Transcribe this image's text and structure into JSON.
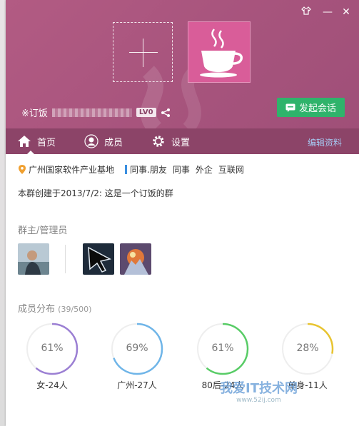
{
  "header": {
    "window_controls": [
      {
        "name": "skin",
        "icon": "shirt-icon"
      },
      {
        "name": "minimize",
        "icon": "minimize-icon",
        "glyph": "—"
      },
      {
        "name": "close",
        "icon": "close-icon",
        "glyph": "✕"
      }
    ],
    "group_name": "※订饭",
    "level": "LV0",
    "chat_button": "发起会话",
    "colors": {
      "header": "#a9557e",
      "tabs": "#8c4468",
      "chat_button": "#2fb36b",
      "avatar": "#d95d99"
    }
  },
  "tabs": [
    {
      "label": "首页",
      "icon": "home-icon",
      "active": true
    },
    {
      "label": "成员",
      "icon": "member-icon",
      "active": false
    },
    {
      "label": "设置",
      "icon": "gear-icon",
      "active": false
    }
  ],
  "edit_link": "编辑资料",
  "tags": {
    "location": "广州国家软件产业基地",
    "items": [
      "同事.朋友",
      "同事",
      "外企",
      "互联网"
    ]
  },
  "description": "本群创建于2013/7/2:  这是一个订饭的群",
  "admins_title": "群主/管理员",
  "members_title": "成员分布",
  "members_count": "(39/500)",
  "chart_data": {
    "type": "ring",
    "items": [
      {
        "label": "女-24人",
        "percent_text": "61%",
        "value": 61,
        "color": "#9b7fd3"
      },
      {
        "label": "广州-27人",
        "percent_text": "69%",
        "value": 69,
        "color": "#6fb5e8"
      },
      {
        "label": "80后-24人",
        "percent_text": "61%",
        "value": 61,
        "color": "#58cc66"
      },
      {
        "label": "单身-11人",
        "percent_text": "28%",
        "value": 28,
        "color": "#e8c430"
      }
    ]
  },
  "watermark": {
    "text": "我爱IT技术网",
    "url": "www.52ij.com"
  }
}
